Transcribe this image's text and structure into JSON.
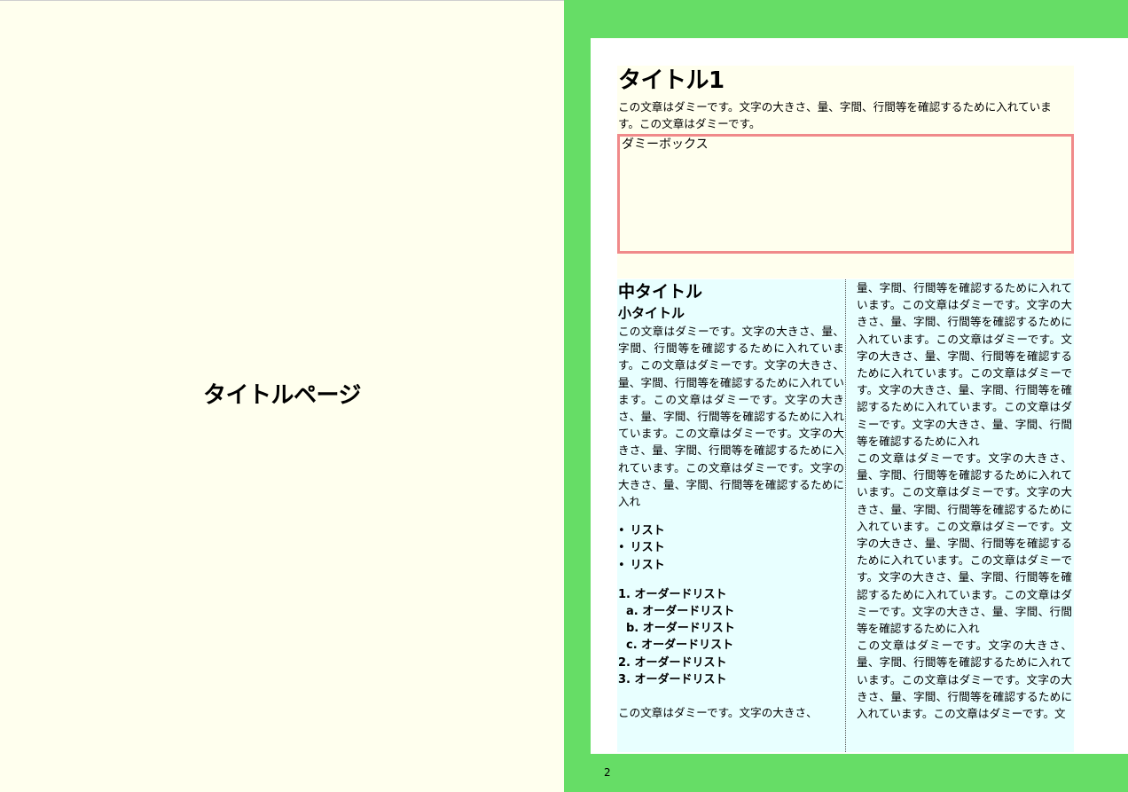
{
  "left_page": {
    "title": "タイトルページ"
  },
  "right_page": {
    "title": "タイトル1",
    "intro": "この文章はダミーです。文字の大きさ、量、字間、行間等を確認するために入れています。この文章はダミーです。",
    "dummy_box_label": "ダミーボックス",
    "left_column": {
      "mid_title": "中タイトル",
      "small_title": "小タイトル",
      "paragraph": "この文章はダミーです。文字の大きさ、量、字間、行間等を確認するために入れています。この文章はダミーです。文字の大きさ、量、字間、行間等を確認するために入れています。この文章はダミーです。文字の大きさ、量、字間、行間等を確認するために入れています。この文章はダミーです。文字の大きさ、量、字間、行間等を確認するために入れています。この文章はダミーです。文字の大きさ、量、字間、行間等を確認するために入れ",
      "bullets": [
        "リスト",
        "リスト",
        "リスト"
      ],
      "ordered_list": {
        "item1": "1. オーダードリスト",
        "sub_items": [
          "a. オーダードリスト",
          "b. オーダードリスト",
          "c. オーダードリスト"
        ],
        "item2": "2. オーダードリスト",
        "item3": "3. オーダードリスト"
      },
      "trailing_text": "この文章はダミーです。文字の大きさ、"
    },
    "right_column": {
      "paragraphs": [
        "量、字間、行間等を確認するために入れています。この文章はダミーです。文字の大きさ、量、字間、行間等を確認するために入れています。この文章はダミーです。文字の大きさ、量、字間、行間等を確認するために入れています。この文章はダミーです。文字の大きさ、量、字間、行間等を確認するために入れています。この文章はダミーです。文字の大きさ、量、字間、行間等を確認するために入れ",
        "この文章はダミーです。文字の大きさ、量、字間、行間等を確認するために入れています。この文章はダミーです。文字の大きさ、量、字間、行間等を確認するために入れています。この文章はダミーです。文字の大きさ、量、字間、行間等を確認するために入れています。この文章はダミーです。文字の大きさ、量、字間、行間等を確認するために入れています。この文章はダミーです。文字の大きさ、量、字間、行間等を確認するために入れ",
        "この文章はダミーです。文字の大きさ、量、字間、行間等を確認するために入れています。この文章はダミーです。文字の大きさ、量、字間、行間等を確認するために入れています。この文章はダミーです。文"
      ]
    },
    "page_number": "2"
  },
  "colors": {
    "left_page_bg": "#ffffee",
    "right_page_frame": "#66dd66",
    "column_bg": "#e8ffff",
    "dummy_box_border": "#f08a8a"
  }
}
